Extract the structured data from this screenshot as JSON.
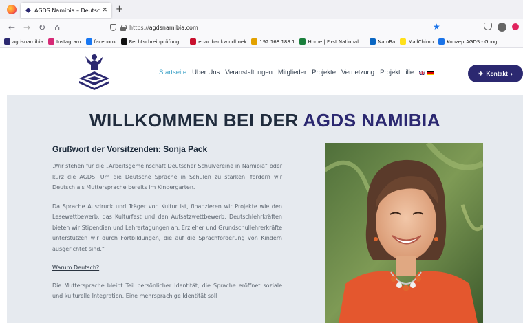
{
  "browser": {
    "tab_title": "AGDS Namibia – Deutsche Spra",
    "url_scheme": "https://",
    "url_host": "agdsnamibia.com"
  },
  "bookmarks": [
    {
      "label": "agdsnamibia",
      "color": "#2b2870"
    },
    {
      "label": "Instagram",
      "color": "#d62976"
    },
    {
      "label": "facebook",
      "color": "#1877f2"
    },
    {
      "label": "Rechtschreibprüfung ...",
      "color": "#111111"
    },
    {
      "label": "epac.bankwindhoek",
      "color": "#c8102e"
    },
    {
      "label": "192.168.188.1",
      "color": "#e2a100"
    },
    {
      "label": "Home | First National ...",
      "color": "#1a7f3c"
    },
    {
      "label": "NamRa",
      "color": "#0a66c2"
    },
    {
      "label": "MailChimp",
      "color": "#ffe01b"
    },
    {
      "label": "KonzeptAGDS - Googl...",
      "color": "#1a73e8"
    }
  ],
  "nav": {
    "items": [
      "Startseite",
      "Über Uns",
      "Veranstaltungen",
      "Mitglieder",
      "Projekte",
      "Vernetzung",
      "Projekt Lilie"
    ],
    "cta_label": "Kontakt"
  },
  "hero": {
    "title_main": "WILLKOMMEN BEI DER ",
    "title_brand": "AGDS NAMIBIA"
  },
  "content": {
    "greeting": "Grußwort der Vorsitzenden: Sonja Pack",
    "p1": "„Wir stehen für die „Arbeitsgemeinschaft Deutscher Schulvereine in Namibia“ oder kurz die AGDS. Um die Deutsche Sprache in Schulen zu stärken, fördern wir Deutsch als Muttersprache bereits im Kindergarten.",
    "p2": "Da Sprache Ausdruck und Träger von Kultur ist, finanzieren wir Projekte wie den Lesewettbewerb, das Kulturfest und den Aufsatzwettbewerb; Deutschlehrkräften bieten wir Stipendien und Lehrertagungen an. Erzieher und Grundschullehrerkräfte unterstützen wir durch Fortbildungen, die auf die Sprachförderung von Kindern ausgerichtet sind.“",
    "subheading": "Warum Deutsch?",
    "p3": "Die Muttersprache bleibt Teil persönlicher Identität, die Sprache eröffnet soziale und kulturelle Integration. Eine mehrsprachige Identität soll"
  },
  "colors": {
    "brand": "#2b2870",
    "active_nav": "#3aa0c6",
    "main_bg": "#e6eaef"
  }
}
